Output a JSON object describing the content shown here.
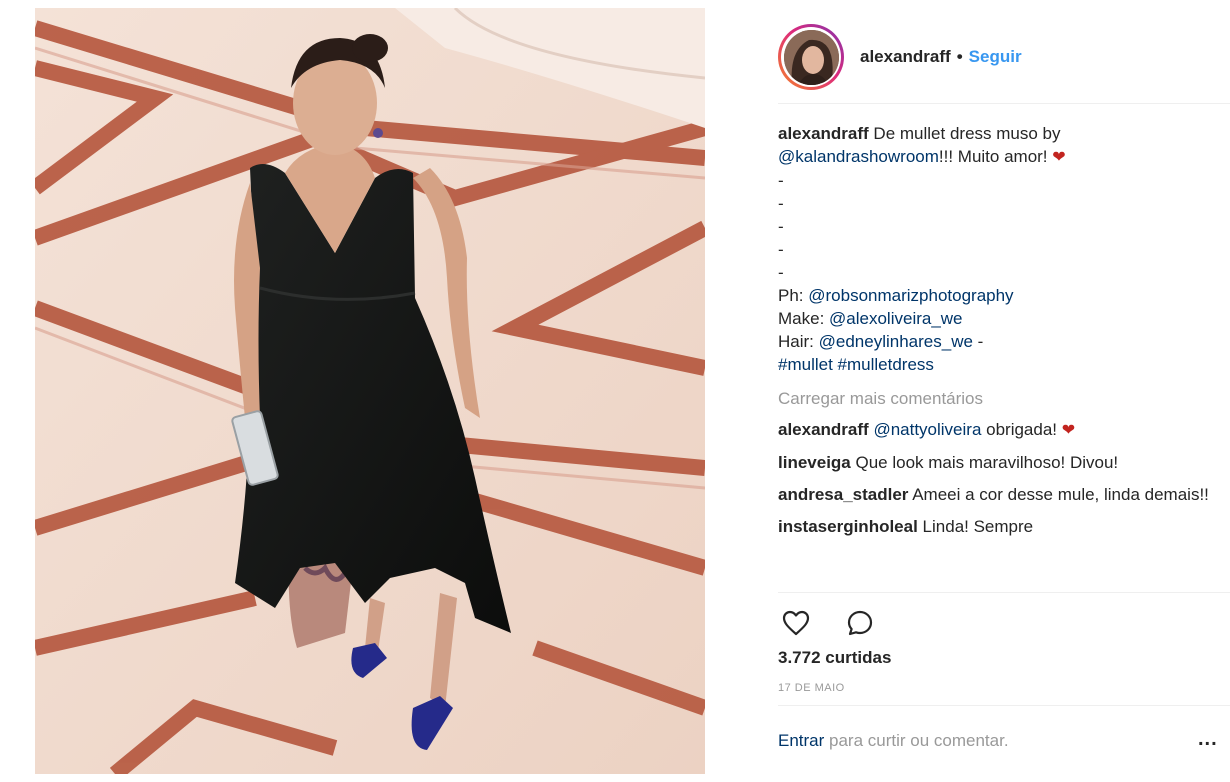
{
  "post": {
    "image_alt": "Mulher em vestido mullet preto sobre piso de mármore",
    "colors": {
      "link": "#003569",
      "follow": "#3897f0",
      "heart": "#c2241f",
      "muted": "#999999"
    }
  },
  "header": {
    "username": "alexandraff",
    "separator": "•",
    "follow_label": "Seguir"
  },
  "caption": {
    "username": "alexandraff",
    "line1_text": " De mullet dress muso by ",
    "mention1": "@kalandrashowroom",
    "line2_text": "!!! Muito amor! ",
    "heart": "❤",
    "dashes": [
      "-",
      "-",
      "-",
      "-",
      "-"
    ],
    "credit_ph_label": "Ph: ",
    "credit_ph_mention": "@robsonmarizphotography",
    "credit_make_label": "Make: ",
    "credit_make_mention": "@alexoliveira_we",
    "credit_hair_label": "Hair: ",
    "credit_hair_mention": "@edneylinhares_we",
    "credit_hair_suffix": " -",
    "hashtag1": "#mullet",
    "hashtag2": "#mulletdress"
  },
  "load_more": "Carregar mais comentários",
  "comments": [
    {
      "username": "alexandraff",
      "mention": "@nattyoliveira",
      "text": " obrigada! ",
      "heart": "❤"
    },
    {
      "username": "lineveiga",
      "text": " Que look mais maravilhoso! Divou!"
    },
    {
      "username": "andresa_stadler",
      "text": " Ameei a cor desse mule, linda demais!!"
    },
    {
      "username": "instaserginholeal",
      "text": " Linda! Sempre"
    }
  ],
  "actions": {
    "like_icon": "heart-outline-icon",
    "comment_icon": "speech-bubble-icon"
  },
  "likes": "3.772 curtidas",
  "date": "17 DE MAIO",
  "footer": {
    "login_label": "Entrar",
    "login_suffix": " para curtir ou comentar.",
    "more_label": "..."
  }
}
